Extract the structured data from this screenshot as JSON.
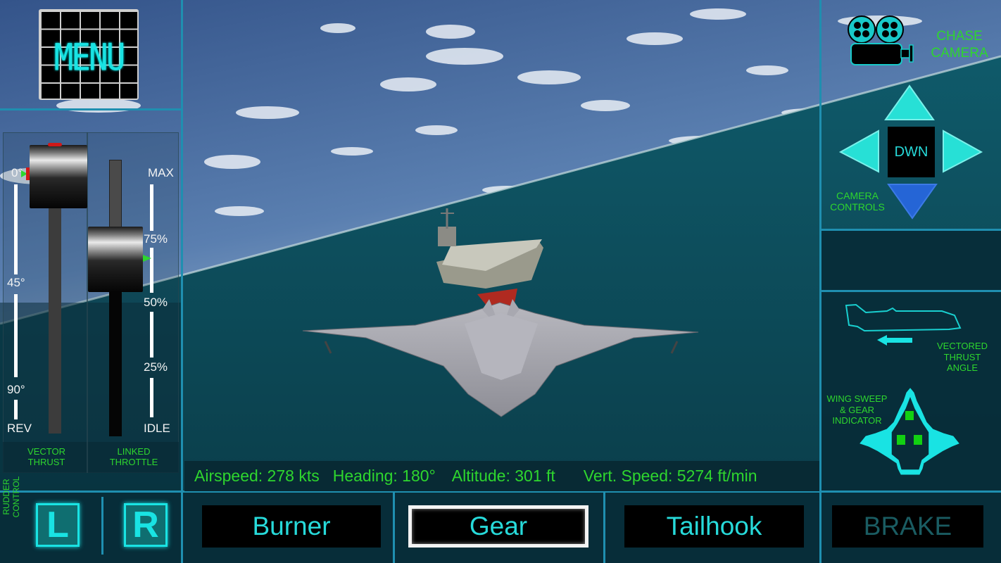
{
  "menu": {
    "label": "MENU"
  },
  "throttle": {
    "vector_scale": [
      "0°",
      "45°",
      "90°",
      "REV"
    ],
    "throttle_scale": [
      "MAX",
      "75%",
      "50%",
      "25%",
      "IDLE"
    ],
    "vector_label": [
      "VECTOR",
      "THRUST"
    ],
    "throttle_label": [
      "LINKED",
      "THROTTLE"
    ],
    "vector_angle_deg": 0,
    "throttle_percent": 68
  },
  "rudder": {
    "label": [
      "RUDDER",
      "CONTROL"
    ],
    "left": "L",
    "right": "R"
  },
  "readout": {
    "airspeed": "Airspeed: 278 kts",
    "heading": "Heading: 180°",
    "altitude": "Altitude: 301 ft",
    "vert_speed": "Vert. Speed: 5274 ft/min"
  },
  "buttons": {
    "burner": "Burner",
    "gear": "Gear",
    "tailhook": "Tailhook",
    "brake": "BRAKE"
  },
  "camera": {
    "mode_label": [
      "CHASE",
      "CAMERA"
    ],
    "center_label": "DWN",
    "controls_label": [
      "CAMERA",
      "CONTROLS"
    ]
  },
  "indicators": {
    "vectored_label": [
      "VECTORED",
      "THRUST",
      "ANGLE"
    ],
    "wing_label": [
      "WING SWEEP",
      "& GEAR",
      "INDICATOR"
    ]
  },
  "colors": {
    "accent_cyan": "#19e3e3",
    "label_green": "#2ed62e",
    "panel_line": "#1f8fb0",
    "dpad_active": "#2565d6"
  }
}
